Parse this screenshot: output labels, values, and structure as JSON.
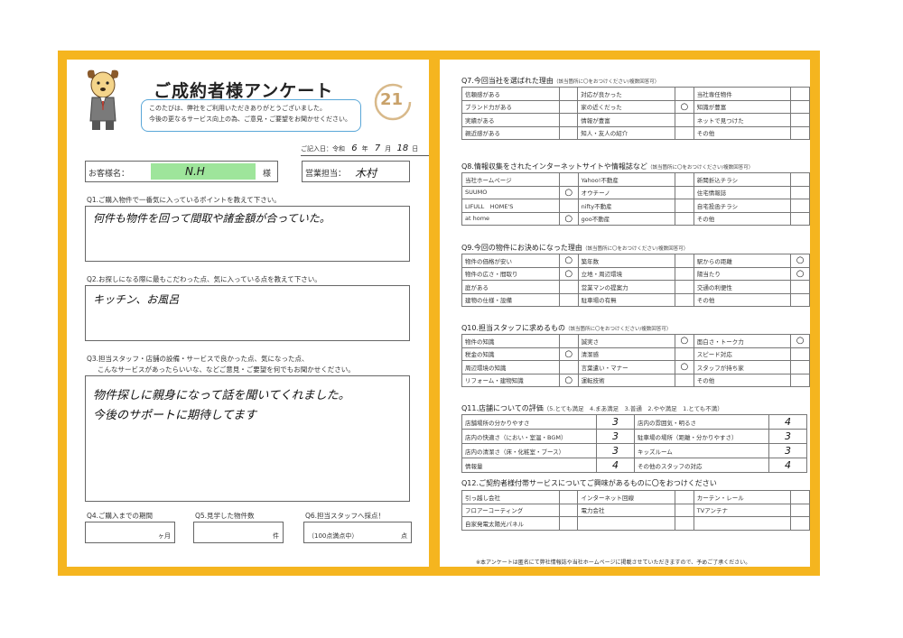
{
  "header": {
    "title": "ご成約者様アンケート",
    "greeting_line1": "このたびは、弊社をご利用いただきありがとうございました。",
    "greeting_line2": "今後の更なるサービス向上の為、ご意見・ご要望をお聞かせください。",
    "logo_text": "21",
    "date_label": "ご記入日：令和",
    "date_year": "6",
    "date_year_unit": "年",
    "date_month": "7",
    "date_month_unit": "月",
    "date_day": "18",
    "date_day_unit": "日"
  },
  "customer": {
    "label": "お客様名：",
    "name": "N.H",
    "suffix": "様",
    "sales_label": "営業担当：",
    "sales_name": "木村"
  },
  "left_questions": [
    {
      "q": "Q1.ご購入物件で一番気に入っているポイントを教えて下さい。",
      "a": "何件も物件を回って間取や諸金額が合っていた。"
    },
    {
      "q": "Q2.お探しになる際に最もこだわった点、気に入っている点を教えて下さい。",
      "a": "キッチン、お風呂"
    },
    {
      "q": "Q3.担当スタッフ・店舗の設備・サービスで良かった点、気になった点、",
      "q2": "こんなサービスがあったらいいな、などご意見・ご要望を何でもお聞かせください。",
      "a1": "物件探しに親身になって話を聞いてくれました。",
      "a2": "今後のサポートに期待してます"
    }
  ],
  "small_questions": [
    {
      "q": "Q4.ご購入までの期間",
      "unit": "ヶ月",
      "pre": ""
    },
    {
      "q": "Q5.見学した物件数",
      "unit": "件",
      "pre": ""
    },
    {
      "q": "Q6.担当スタッフへ採点！",
      "unit": "点",
      "pre": "（100点満点中）"
    }
  ],
  "q7": {
    "title": "Q7.今回当社を選ばれた理由",
    "note": "（該当箇所に〇をおつけください/複数回答可）",
    "rows": [
      [
        [
          "信頼感がある",
          ""
        ],
        [
          "対応が良かった",
          ""
        ],
        [
          "当社専任物件",
          ""
        ]
      ],
      [
        [
          "ブランド力がある",
          ""
        ],
        [
          "家の近くだった",
          "○"
        ],
        [
          "知識が豊富",
          ""
        ]
      ],
      [
        [
          "実績がある",
          ""
        ],
        [
          "情報が豊富",
          ""
        ],
        [
          "ネットで見つけた",
          ""
        ]
      ],
      [
        [
          "親近感がある",
          ""
        ],
        [
          "知人・友人の紹介",
          ""
        ],
        [
          "その他",
          ""
        ]
      ]
    ]
  },
  "q8": {
    "title": "Q8.情報収集をされたインターネットサイトや情報誌など",
    "note": "（該当箇所に〇をおつけください/複数回答可）",
    "rows": [
      [
        [
          "当社ホームページ",
          ""
        ],
        [
          "Yahoo!不動産",
          ""
        ],
        [
          "新聞折込チラシ",
          ""
        ]
      ],
      [
        [
          "SUUMO",
          "○"
        ],
        [
          "オウチーノ",
          ""
        ],
        [
          "住宅情報誌",
          ""
        ]
      ],
      [
        [
          "LIFULL　HOME'S",
          ""
        ],
        [
          "nifty不動産",
          ""
        ],
        [
          "自宅投函チラシ",
          ""
        ]
      ],
      [
        [
          "at home",
          "○"
        ],
        [
          "goo不動産",
          ""
        ],
        [
          "その他",
          ""
        ]
      ]
    ]
  },
  "q9": {
    "title": "Q9.今回の物件にお決めになった理由",
    "note": "（該当箇所に〇をおつけください/複数回答可）",
    "rows": [
      [
        [
          "物件の価格が安い",
          "○"
        ],
        [
          "築年数",
          ""
        ],
        [
          "駅からの距離",
          "○"
        ]
      ],
      [
        [
          "物件の広さ・間取り",
          "○"
        ],
        [
          "立地・周辺環境",
          ""
        ],
        [
          "陽当たり",
          "○"
        ]
      ],
      [
        [
          "庭がある",
          ""
        ],
        [
          "営業マンの提案力",
          ""
        ],
        [
          "交通の利便性",
          ""
        ]
      ],
      [
        [
          "建物の仕様・設備",
          ""
        ],
        [
          "駐車場の有無",
          ""
        ],
        [
          "その他",
          ""
        ]
      ]
    ]
  },
  "q10": {
    "title": "Q10.担当スタッフに求めるもの",
    "note": "（該当箇所に〇をおつけください/複数回答可）",
    "rows": [
      [
        [
          "物件の知識",
          ""
        ],
        [
          "誠実さ",
          "○"
        ],
        [
          "面白さ・トーク力",
          "○"
        ]
      ],
      [
        [
          "税金の知識",
          "○"
        ],
        [
          "清潔感",
          ""
        ],
        [
          "スピード対応",
          ""
        ]
      ],
      [
        [
          "周辺環境の知識",
          ""
        ],
        [
          "言葉遣い・マナー",
          "○"
        ],
        [
          "スタッフが持ち家",
          ""
        ]
      ],
      [
        [
          "リフォーム・建物知識",
          "○"
        ],
        [
          "運転技術",
          ""
        ],
        [
          "その他",
          ""
        ]
      ]
    ]
  },
  "q11": {
    "title": "Q11.店舗についての評価",
    "note": "（5.とても満足　4.まあ満足　3.普通　2.やや満足　1.とても不満）",
    "rows": [
      [
        [
          "店舗場所の分かりやすさ",
          "3"
        ],
        [
          "店内の雰囲気・明るさ",
          "4"
        ]
      ],
      [
        [
          "店内の快適さ（におい・室温・BGM）",
          "3"
        ],
        [
          "駐車場の場所（距離・分かりやすさ）",
          "3"
        ]
      ],
      [
        [
          "店内の清潔さ（床・化粧室・ブース）",
          "3"
        ],
        [
          "キッズルーム",
          "3"
        ]
      ],
      [
        [
          "情報量",
          "4"
        ],
        [
          "その他のスタッフの対応",
          "4"
        ]
      ]
    ]
  },
  "q12": {
    "title": "Q12.ご契約者様付帯サービスについてご興味があるものに〇をおつけください",
    "rows": [
      [
        [
          "引っ越し会社",
          ""
        ],
        [
          "インターネット回線",
          ""
        ],
        [
          "カーテン・レール",
          ""
        ]
      ],
      [
        [
          "フロアーコーティング",
          ""
        ],
        [
          "電力会社",
          ""
        ],
        [
          "TVアンテナ",
          ""
        ]
      ],
      [
        [
          "自家発電太陽光パネル",
          ""
        ],
        [
          "",
          ""
        ],
        [
          "",
          ""
        ]
      ]
    ]
  },
  "footer": "※本アンケートは匿名にて弊社情報誌や当社ホームページに掲載させていただきますので、予めご了承ください。",
  "colors": {
    "frame": "#f5b51f",
    "bubble": "#5aa7d8",
    "highlight": "#9ee59b"
  },
  "icons": {
    "mascot": "dog-mascot-icon",
    "logo": "century21-logo-icon"
  }
}
